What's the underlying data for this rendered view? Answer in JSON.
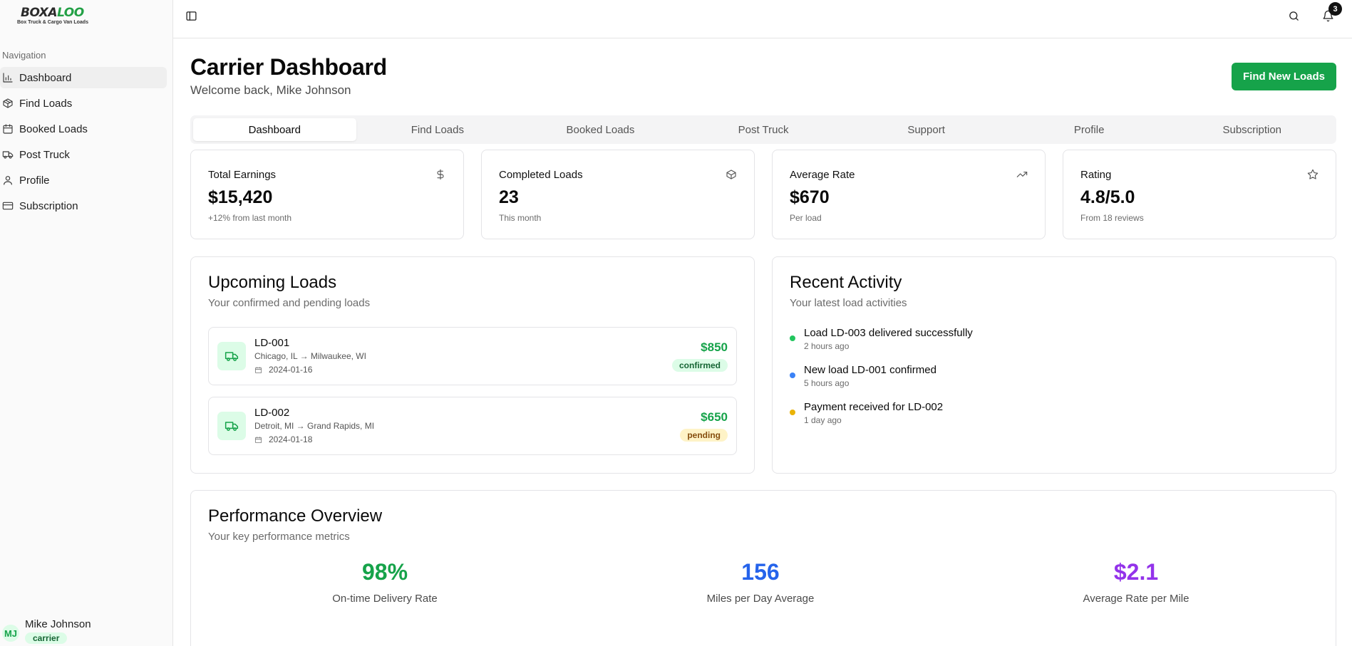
{
  "brand": {
    "logo_part1": "BOXA",
    "logo_part2": "LOO",
    "tagline": "Box Truck & Cargo Van Loads"
  },
  "sidebar": {
    "heading": "Navigation",
    "items": [
      {
        "label": "Dashboard",
        "icon": "bar-chart-icon",
        "active": true
      },
      {
        "label": "Find Loads",
        "icon": "package-icon"
      },
      {
        "label": "Booked Loads",
        "icon": "calendar-icon"
      },
      {
        "label": "Post Truck",
        "icon": "truck-icon"
      },
      {
        "label": "Profile",
        "icon": "user-icon"
      },
      {
        "label": "Subscription",
        "icon": "credit-card-icon"
      }
    ],
    "user": {
      "initials": "MJ",
      "name": "Mike Johnson",
      "role": "carrier"
    }
  },
  "topbar": {
    "notification_count": "3"
  },
  "header": {
    "title": "Carrier Dashboard",
    "subtitle": "Welcome back, Mike Johnson",
    "cta_label": "Find New Loads"
  },
  "tabs": [
    "Dashboard",
    "Find Loads",
    "Booked Loads",
    "Post Truck",
    "Support",
    "Profile",
    "Subscription"
  ],
  "stats": [
    {
      "title": "Total Earnings",
      "value": "$15,420",
      "note": "+12% from last month",
      "icon": "dollar-icon"
    },
    {
      "title": "Completed Loads",
      "value": "23",
      "note": "This month",
      "icon": "package-icon"
    },
    {
      "title": "Average Rate",
      "value": "$670",
      "note": "Per load",
      "icon": "trending-up-icon"
    },
    {
      "title": "Rating",
      "value": "4.8/5.0",
      "note": "From 18 reviews",
      "icon": "star-icon"
    }
  ],
  "upcoming": {
    "title": "Upcoming Loads",
    "subtitle": "Your confirmed and pending loads",
    "loads": [
      {
        "id": "LD-001",
        "route": "Chicago, IL → Milwaukee, WI",
        "date": "2024-01-16",
        "price": "$850",
        "status": "confirmed"
      },
      {
        "id": "LD-002",
        "route": "Detroit, MI → Grand Rapids, MI",
        "date": "2024-01-18",
        "price": "$650",
        "status": "pending"
      }
    ]
  },
  "activity": {
    "title": "Recent Activity",
    "subtitle": "Your latest load activities",
    "items": [
      {
        "text": "Load LD-003 delivered successfully",
        "time": "2 hours ago",
        "color": "#22c55e"
      },
      {
        "text": "New load LD-001 confirmed",
        "time": "5 hours ago",
        "color": "#3b82f6"
      },
      {
        "text": "Payment received for LD-002",
        "time": "1 day ago",
        "color": "#eab308"
      }
    ]
  },
  "performance": {
    "title": "Performance Overview",
    "subtitle": "Your key performance metrics",
    "metrics": [
      {
        "value": "98%",
        "label": "On-time Delivery Rate",
        "color": "#16a34a"
      },
      {
        "value": "156",
        "label": "Miles per Day Average",
        "color": "#2563eb"
      },
      {
        "value": "$2.1",
        "label": "Average Rate per Mile",
        "color": "#9333ea"
      }
    ]
  },
  "colors": {
    "accent": "#16a34a"
  }
}
